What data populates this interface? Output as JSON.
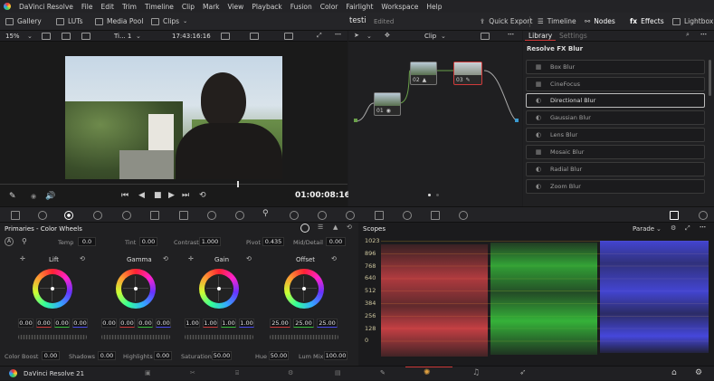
{
  "menubar": {
    "app": "DaVinci Resolve",
    "items": [
      "File",
      "Edit",
      "Trim",
      "Timeline",
      "Clip",
      "Mark",
      "View",
      "Playback",
      "Fusion",
      "Color",
      "Fairlight",
      "Workspace",
      "Help"
    ]
  },
  "toolbar": {
    "left": [
      "Gallery",
      "LUTs",
      "Media Pool",
      "Clips"
    ],
    "project": "testi",
    "status": "Edited",
    "right": [
      "Quick Export",
      "Timeline",
      "Nodes",
      "Effects",
      "Lightbox"
    ]
  },
  "viewer_bar": {
    "zoom": "15%",
    "timeline": "Ti... 1",
    "timecode": "17:43:16:16",
    "clip_mode": "Clip"
  },
  "viewer": {
    "current_timecode": "01:00:08:16"
  },
  "nodes": [
    {
      "label": "01"
    },
    {
      "label": "02"
    },
    {
      "label": "03"
    }
  ],
  "effects_panel": {
    "tabs": [
      "Library",
      "Settings"
    ],
    "section": "Resolve FX Blur",
    "items": [
      "Box Blur",
      "CineFocus",
      "Directional Blur",
      "Gaussian Blur",
      "Lens Blur",
      "Mosaic Blur",
      "Radial Blur",
      "Zoom Blur"
    ],
    "selected": "Directional Blur"
  },
  "color_wheels": {
    "title": "Primaries - Color Wheels",
    "temp_label": "Temp",
    "temp": "0.0",
    "tint_label": "Tint",
    "tint": "0.00",
    "contrast_label": "Contrast",
    "contrast": "1.000",
    "pivot_label": "Pivot",
    "pivot": "0.435",
    "middetail_label": "Mid/Detail",
    "middetail": "0.00",
    "wheels": [
      {
        "name": "Lift",
        "values": [
          "0.00",
          "0.00",
          "0.00",
          "0.00"
        ]
      },
      {
        "name": "Gamma",
        "values": [
          "0.00",
          "0.00",
          "0.00",
          "0.00"
        ]
      },
      {
        "name": "Gain",
        "values": [
          "1.00",
          "1.00",
          "1.00",
          "1.00"
        ]
      },
      {
        "name": "Offset",
        "values": [
          "25.00",
          "25.00",
          "25.00"
        ]
      }
    ],
    "colorboost_label": "Color Boost",
    "colorboost": "0.00",
    "shadows_label": "Shadows",
    "shadows": "0.00",
    "highlights_label": "Highlights",
    "highlights": "0.00",
    "saturation_label": "Saturation",
    "saturation": "50.00",
    "hue_label": "Hue",
    "hue": "50.00",
    "lummix_label": "Lum Mix",
    "lummix": "100.00"
  },
  "scopes": {
    "title": "Scopes",
    "mode": "Parade",
    "scale": [
      "1023",
      "896",
      "768",
      "640",
      "512",
      "384",
      "256",
      "128",
      "0"
    ]
  },
  "bottom_bar": {
    "app_version": "DaVinci Resolve 21"
  },
  "colors": {
    "accent": "#d03b3b",
    "red_channel": "#e0454a",
    "green_channel": "#38c23c",
    "blue_channel": "#4a4cf0"
  }
}
